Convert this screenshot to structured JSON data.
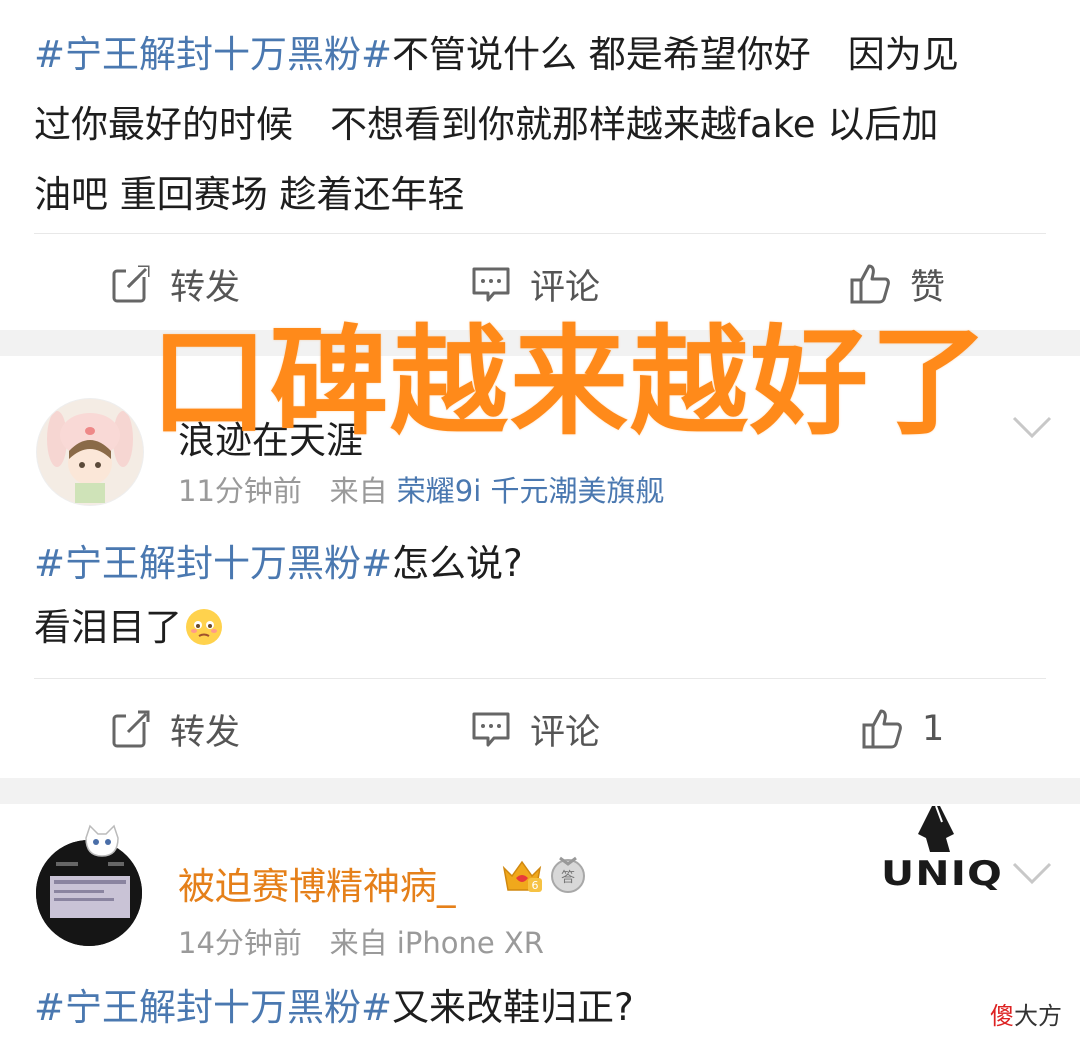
{
  "post1": {
    "hashtag": "#宁王解封十万黑粉#",
    "text_line1": "不管说什么 都是希望你好　因为见",
    "text_line2": "过你最好的时候　不想看到你就那样越来越fake 以后加",
    "text_line3": "油吧 重回赛场 趁着还年轻",
    "actions": {
      "repost": "转发",
      "comment": "评论",
      "like": "赞"
    }
  },
  "overlay": {
    "text": "口碑越来越好了",
    "color": "#ff8a1a"
  },
  "post2": {
    "username": "浪迹在天涯",
    "time": "11分钟前",
    "from_label": "来自",
    "device": "荣耀9i 千元潮美旗舰",
    "hashtag": "#宁王解封十万黑粉#",
    "text_line1": "怎么说?",
    "text_line2": "看泪目了",
    "actions": {
      "repost": "转发",
      "comment": "评论",
      "like": "1"
    }
  },
  "post3": {
    "username": "被迫赛博精神病_",
    "username_color": "#e5801a",
    "time": "14分钟前",
    "from_label": "来自",
    "device": "iPhone XR",
    "badge_level": "6",
    "corner_logo": "UNIQ",
    "hashtag": "#宁王解封十万黑粉#",
    "text_line1": "又来改鞋归正?"
  },
  "watermark": {
    "red": "傻",
    "rest": "大方"
  },
  "colors": {
    "link": "#4a78b0",
    "meta": "#9a9a9a",
    "gap": "#f2f2f2"
  },
  "icons": [
    "repost-icon",
    "comment-icon",
    "like-icon",
    "chevron-down-icon",
    "crown-badge-icon",
    "medal-badge-icon",
    "unicorn-logo-icon"
  ]
}
